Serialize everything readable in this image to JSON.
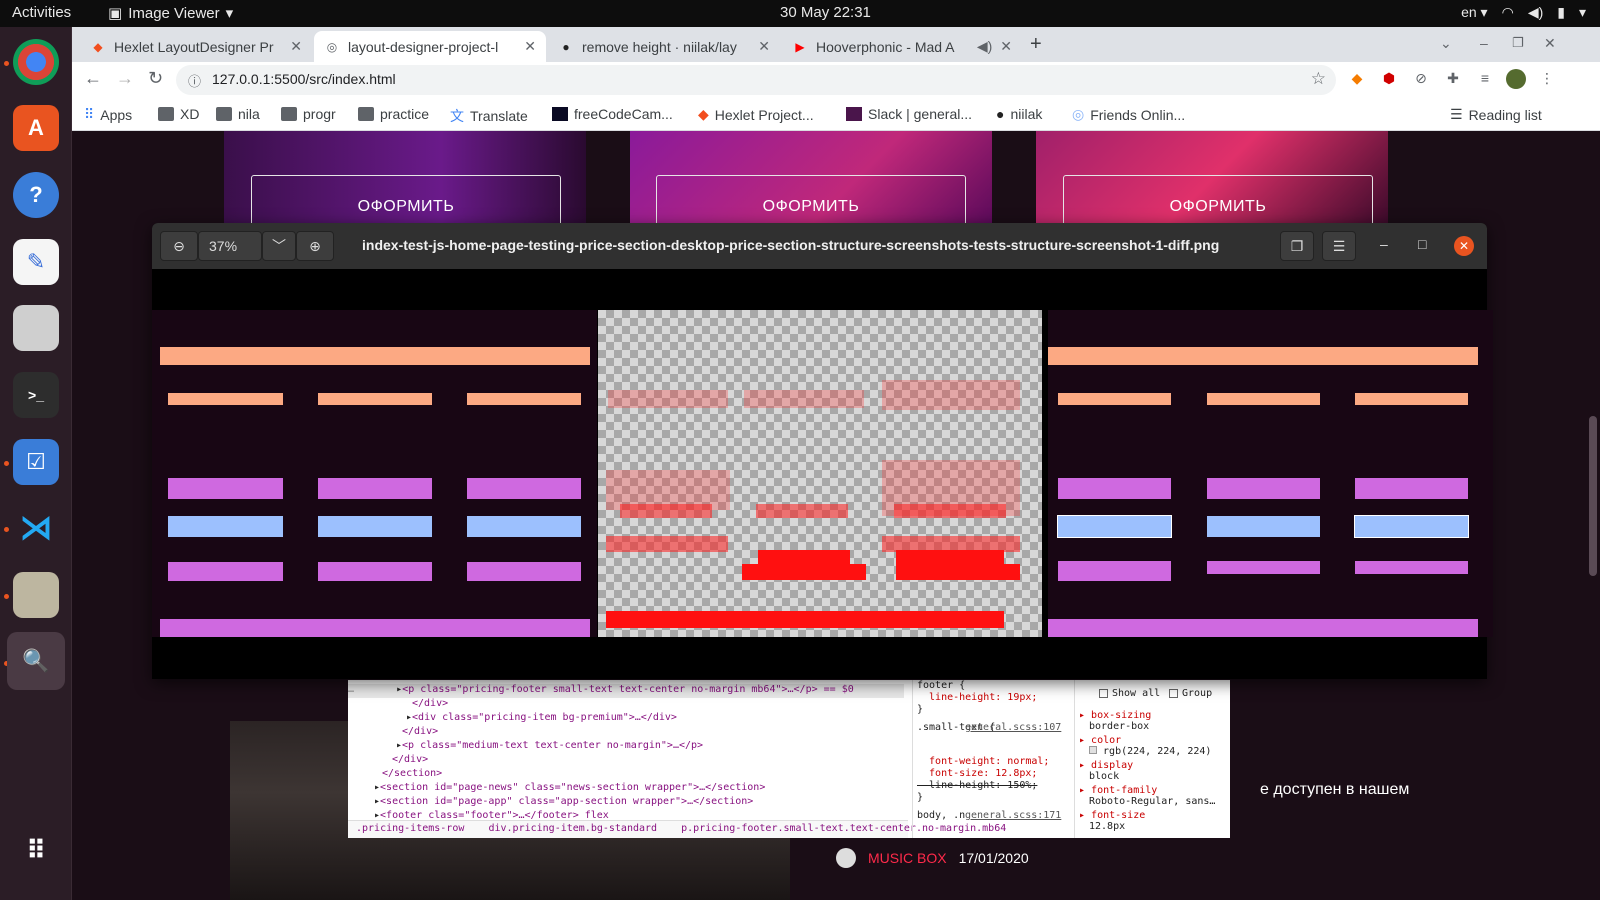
{
  "topbar": {
    "activities": "Activities",
    "app_menu": "Image Viewer",
    "clock": "30 May  22:31",
    "lang": "en"
  },
  "browser": {
    "tabs": [
      {
        "label": "Hexlet LayoutDesigner Pr",
        "icon": "figma-icon"
      },
      {
        "label": "layout-designer-project-l",
        "icon": "globe-icon",
        "active": true
      },
      {
        "label": "remove height · niilak/lay",
        "icon": "github-icon"
      },
      {
        "label": "Hooverphonic - Mad A",
        "icon": "youtube-icon"
      }
    ],
    "url": "127.0.0.1:5500/src/index.html",
    "bookmarks": [
      "Apps",
      "XD",
      "nila",
      "progr",
      "practice",
      "Translate",
      "freeCodeCam...",
      "Hexlet Project...",
      "Slack | general...",
      "niilak",
      "Friends Onlin..."
    ],
    "reading_list": "Reading list"
  },
  "page": {
    "order_buttons": [
      "ОФОРМИТЬ",
      "ОФОРМИТЬ",
      "ОФОРМИТЬ"
    ],
    "partial_text": "е доступен в нашем",
    "music_box": {
      "name": "MUSIC BOX",
      "date": "17/01/2020"
    }
  },
  "viewer": {
    "zoom": "37%",
    "title": "index-test-js-home-page-testing-price-section-desktop-price-section-structure-screenshots-tests-structure-screenshot-1-diff.png"
  },
  "devtools": {
    "lines": [
      {
        "text": "<p class=\"pricing-footer small-text text-center no-margin mb64\">…</p> == $0"
      },
      {
        "text": "</div>"
      },
      {
        "text": "<div class=\"pricing-item bg-premium\">…</div>"
      },
      {
        "text": "</div>"
      },
      {
        "text": "<p class=\"medium-text text-center no-margin\">…</p>"
      },
      {
        "text": "</div>"
      },
      {
        "text": "</section>"
      },
      {
        "text": "<section id=\"page-news\" class=\"news-section wrapper\">…</section>"
      },
      {
        "text": "<section id=\"page-app\" class=\"app-section wrapper\">…</section>"
      },
      {
        "text": "<footer class=\"footer\">…</footer>  flex"
      }
    ],
    "breadcrumb": [
      ".pricing-items-row",
      "div.pricing-item.bg-standard",
      "p.pricing-footer.small-text.text-center.no-margin.mb64"
    ],
    "styles": [
      "footer {",
      "  line-height: 19px;",
      "}",
      ".small-text {",
      "general.scss:107",
      "  font-weight: normal;",
      "  font-size: 12.8px;",
      "  line-height: 150%;",
      "}",
      "body, .no-margin {",
      "general.scss:171"
    ],
    "computed": {
      "show_all": "Show all",
      "group": "Group",
      "props": [
        {
          "name": "box-sizing",
          "value": "border-box"
        },
        {
          "name": "color",
          "value": "rgb(224, 224, 224)"
        },
        {
          "name": "display",
          "value": "block"
        },
        {
          "name": "font-family",
          "value": "Roboto-Regular, sans…"
        },
        {
          "name": "font-size",
          "value": "12.8px"
        }
      ]
    }
  },
  "colors": {
    "salmon": "#fca983",
    "violet": "#cf69e0",
    "blue": "#9cc0fe",
    "diff_red": "#ff1010",
    "ubuntu_orange": "#e95420"
  }
}
